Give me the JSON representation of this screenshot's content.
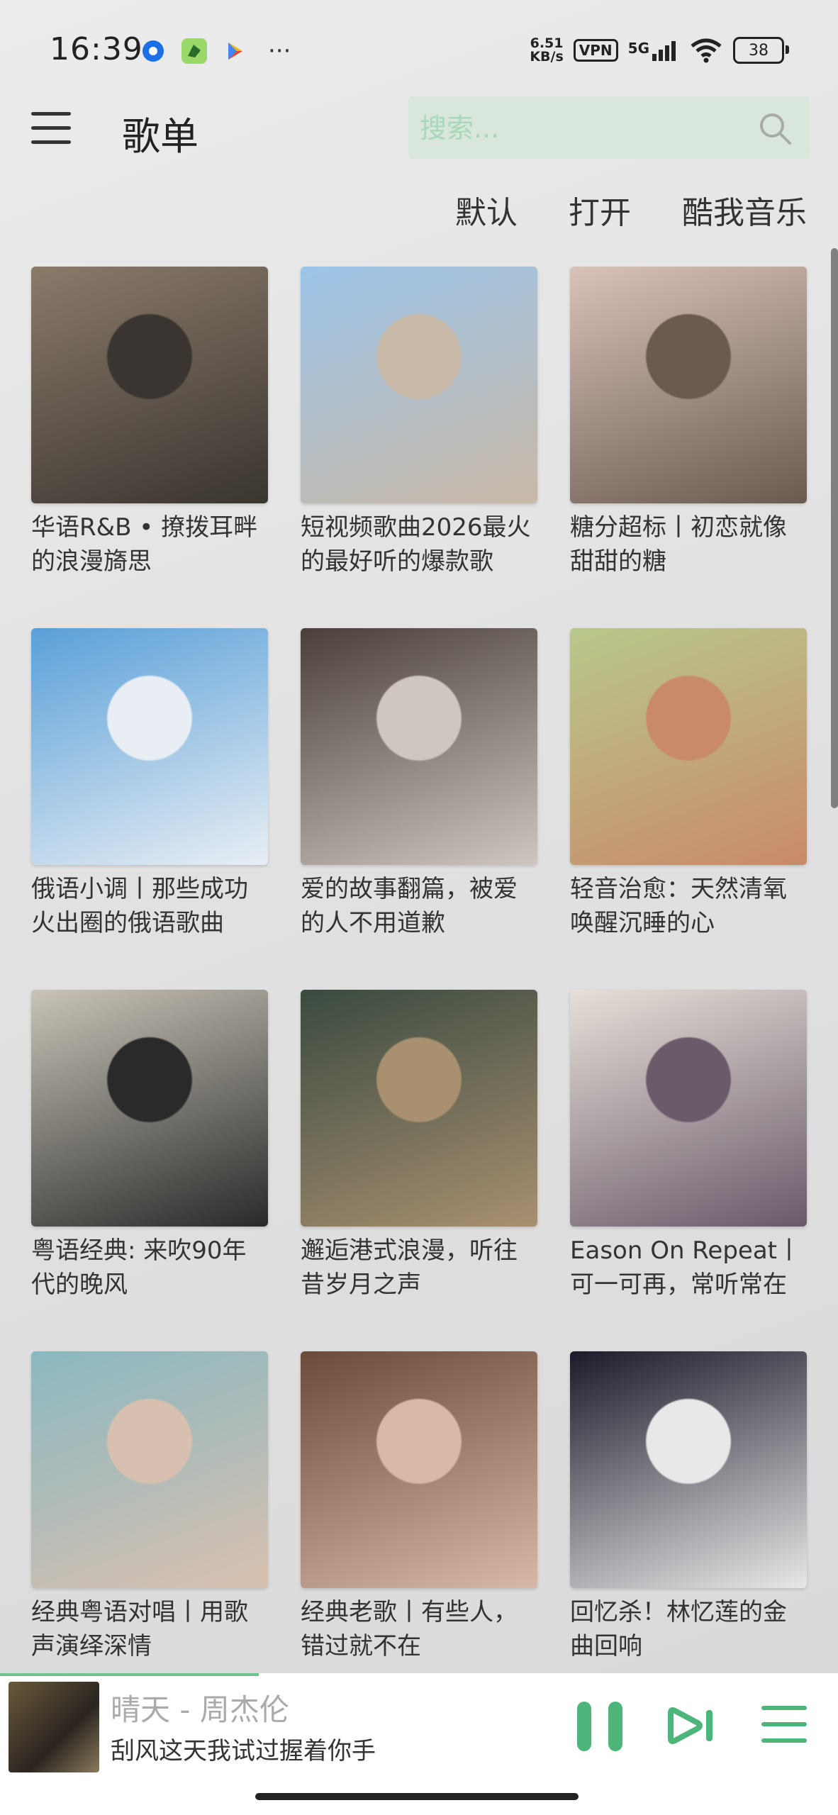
{
  "status_bar": {
    "time": "16:39",
    "speed_line1": "6.51",
    "speed_line2": "KB/s",
    "vpn": "VPN",
    "network": "5G",
    "battery": "38"
  },
  "header": {
    "title": "歌单",
    "search_placeholder": "搜索..."
  },
  "sort_tabs": [
    "默认",
    "打开",
    "酷我音乐"
  ],
  "playlists": [
    {
      "title": "华语R&B • 撩拨耳畔的浪漫旖思",
      "colors": [
        "#8a7a6a",
        "#3a3530"
      ]
    },
    {
      "title": "短视频歌曲2026最火的最好听的爆款歌",
      "colors": [
        "#9cc4e8",
        "#c9b9a8"
      ]
    },
    {
      "title": "糖分超标丨初恋就像甜甜的糖",
      "colors": [
        "#d9c3b8",
        "#6a5a50"
      ]
    },
    {
      "title": "俄语小调丨那些成功火出圈的俄语歌曲",
      "colors": [
        "#5aa0d8",
        "#e8eef4"
      ]
    },
    {
      "title": "爱的故事翻篇，被爱的人不用道歉",
      "colors": [
        "#4a3f3a",
        "#cfc6c0"
      ]
    },
    {
      "title": "轻音治愈：天然清氧唤醒沉睡的心",
      "colors": [
        "#b8c98a",
        "#c98a6a"
      ]
    },
    {
      "title": "粤语经典: 来吹90年代的晚风",
      "colors": [
        "#c9c4b8",
        "#2a2a2a"
      ]
    },
    {
      "title": "邂逅港式浪漫，听往昔岁月之声",
      "colors": [
        "#3a4a40",
        "#a89070"
      ]
    },
    {
      "title": "Eason On Repeat丨可一可再，常听常在",
      "colors": [
        "#e6e0d8",
        "#6a5a6a"
      ]
    },
    {
      "title": "经典粤语对唱丨用歌声演绎深情",
      "colors": [
        "#8ab8c0",
        "#d8c0b0"
      ]
    },
    {
      "title": "经典老歌丨有些人，错过就不在",
      "colors": [
        "#6a4a3a",
        "#d8b8a8"
      ]
    },
    {
      "title": "回忆杀！林忆莲的金曲回响",
      "colors": [
        "#1a1a2a",
        "#e8e8e8"
      ]
    }
  ],
  "player": {
    "title": "晴天 - 周杰伦",
    "lyric": "刮风这天我试过握着你手",
    "accent": "#4db57a"
  }
}
